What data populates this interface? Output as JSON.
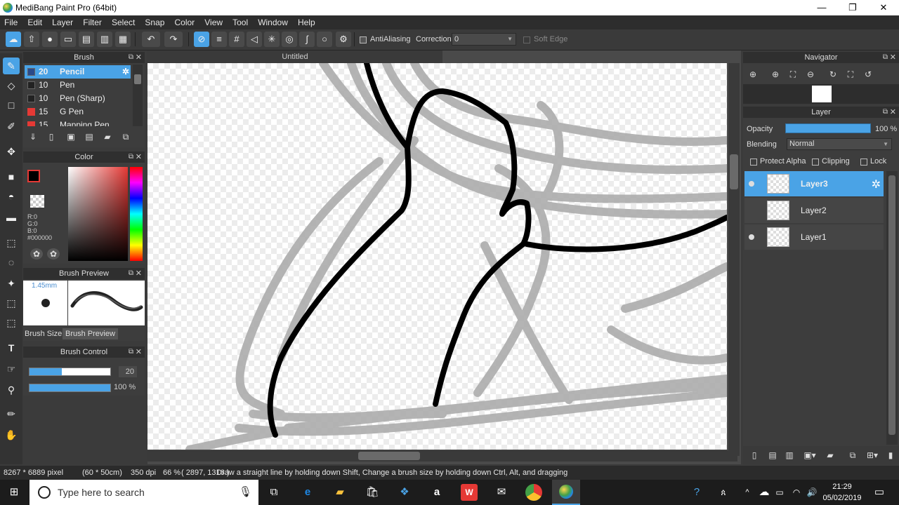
{
  "window": {
    "title": "MediBang Paint Pro (64bit)",
    "min": "—",
    "max": "❐",
    "close": "✕"
  },
  "menu": [
    "File",
    "Edit",
    "Layer",
    "Filter",
    "Select",
    "Snap",
    "Color",
    "View",
    "Tool",
    "Window",
    "Help"
  ],
  "toolbar": {
    "antialiasing_label": "AntiAliasing",
    "correction_label": "Correction",
    "correction_value": "0",
    "soft_edge_label": "Soft Edge"
  },
  "brush_panel": {
    "title": "Brush",
    "items": [
      {
        "size": "20",
        "name": "Pencil",
        "color": "#2a4a8a"
      },
      {
        "size": "10",
        "name": "Pen",
        "color": "#222222"
      },
      {
        "size": "10",
        "name": "Pen (Sharp)",
        "color": "#222222"
      },
      {
        "size": "15",
        "name": "G Pen",
        "color": "#e53935"
      },
      {
        "size": "15",
        "name": "Mapping Pen",
        "color": "#e53935"
      }
    ]
  },
  "color_panel": {
    "title": "Color",
    "r": "R:0",
    "g": "G:0",
    "b": "B:0",
    "hex": "#000000"
  },
  "brush_preview": {
    "title": "Brush Preview",
    "size": "1.45mm",
    "tab1": "Brush Size",
    "tab2": "Brush Preview"
  },
  "brush_control": {
    "title": "Brush Control",
    "size_value": "20",
    "size_fraction": 0.4,
    "opacity_value": "100 %",
    "opacity_fraction": 1.0
  },
  "document": {
    "tab": "Untitled"
  },
  "navigator": {
    "title": "Navigator"
  },
  "layer_panel": {
    "title": "Layer",
    "opacity_label": "Opacity",
    "opacity_value": "100 %",
    "blending_label": "Blending",
    "blending_value": "Normal",
    "protect_alpha": "Protect Alpha",
    "clipping": "Clipping",
    "lock": "Lock",
    "layers": [
      {
        "name": "Layer3",
        "active": true
      },
      {
        "name": "Layer2",
        "active": false
      },
      {
        "name": "Layer1",
        "active": false
      }
    ]
  },
  "status": {
    "size": "8267 * 6889 pixel",
    "cm": "(60 * 50cm)",
    "dpi": "350 dpi",
    "zoom": "66 %",
    "coords": "( 2897, 1316 )",
    "hint": "Draw a straight line by holding down Shift, Change a brush size by holding down Ctrl, Alt, and dragging"
  },
  "taskbar": {
    "search_placeholder": "Type here to search",
    "time": "21:29",
    "date": "05/02/2019"
  }
}
